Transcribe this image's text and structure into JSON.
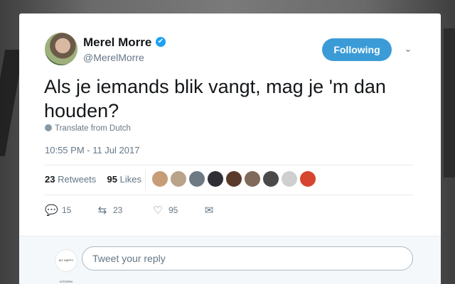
{
  "author": {
    "name": "Merel Morre",
    "handle": "@MerelMorre",
    "verified": true,
    "verified_icon": "✔"
  },
  "actions_top": {
    "follow_label": "Following",
    "more_icon": "⌄"
  },
  "tweet": {
    "text": "Als je iemands blik vangt, mag je 'm dan houden?",
    "translate_label": "Translate from Dutch",
    "timestamp": "10:55 PM - 11 Jul 2017"
  },
  "stats": {
    "retweets_count": "23",
    "retweets_label": "Retweets",
    "likes_count": "95",
    "likes_label": "Likes",
    "liker_colors": [
      "#c79d78",
      "#b9a389",
      "#6d7a84",
      "#2f2f35",
      "#5a3a2b",
      "#7f6a5b",
      "#4a4a4a",
      "#cfcfcf",
      "#d6452f"
    ]
  },
  "action_bar": {
    "reply_icon": "💬",
    "reply_count": "15",
    "retweet_icon": "⇆",
    "retweet_count": "23",
    "like_icon": "♡",
    "like_count": "95",
    "dm_icon": "✉"
  },
  "reply": {
    "placeholder": "Tweet your reply",
    "avatar_text": "MY HAPPY KITCHEN"
  },
  "colors": {
    "accent": "#3b9bd7",
    "verified": "#1da1f2",
    "secondary_text": "#657786"
  }
}
